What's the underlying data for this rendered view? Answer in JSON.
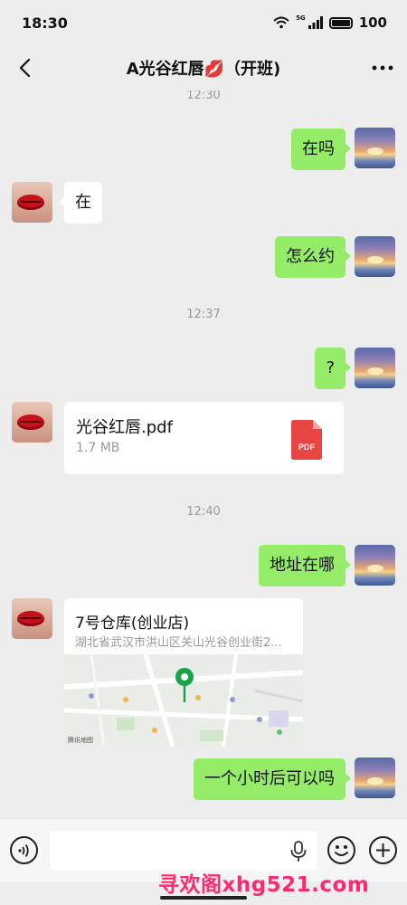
{
  "status": {
    "time": "18:30",
    "network": "5G",
    "battery": "100"
  },
  "header": {
    "title": "A光谷红唇💋（开班)"
  },
  "timestamps": [
    "12:30",
    "12:37",
    "12:40"
  ],
  "messages": {
    "m1": "在吗",
    "m2": "在",
    "m3": "怎么约",
    "m4": "?",
    "m5": "地址在哪",
    "m6": "一个小时后可以吗"
  },
  "file": {
    "name": "光谷红唇.pdf",
    "size": "1.7 MB",
    "icon_label": "PDF"
  },
  "location": {
    "name": "7号仓库(创业店)",
    "address": "湖北省武汉市洪山区关山光谷创业街2...",
    "map_credit": "腾讯地图"
  },
  "input": {
    "placeholder": ""
  },
  "watermark": "寻欢阁xhg521.com",
  "colors": {
    "my_bubble": "#95ec69",
    "their_bubble": "#ffffff",
    "background": "#ededed",
    "map_pin": "#16a34a",
    "watermark": "#ff2a6e"
  },
  "icons": [
    "back-arrow-icon",
    "more-icon",
    "voice-icon",
    "mic-icon",
    "emoji-icon",
    "plus-icon",
    "pdf-icon",
    "map-pin-icon",
    "wifi-icon",
    "signal-icon",
    "battery-icon"
  ]
}
